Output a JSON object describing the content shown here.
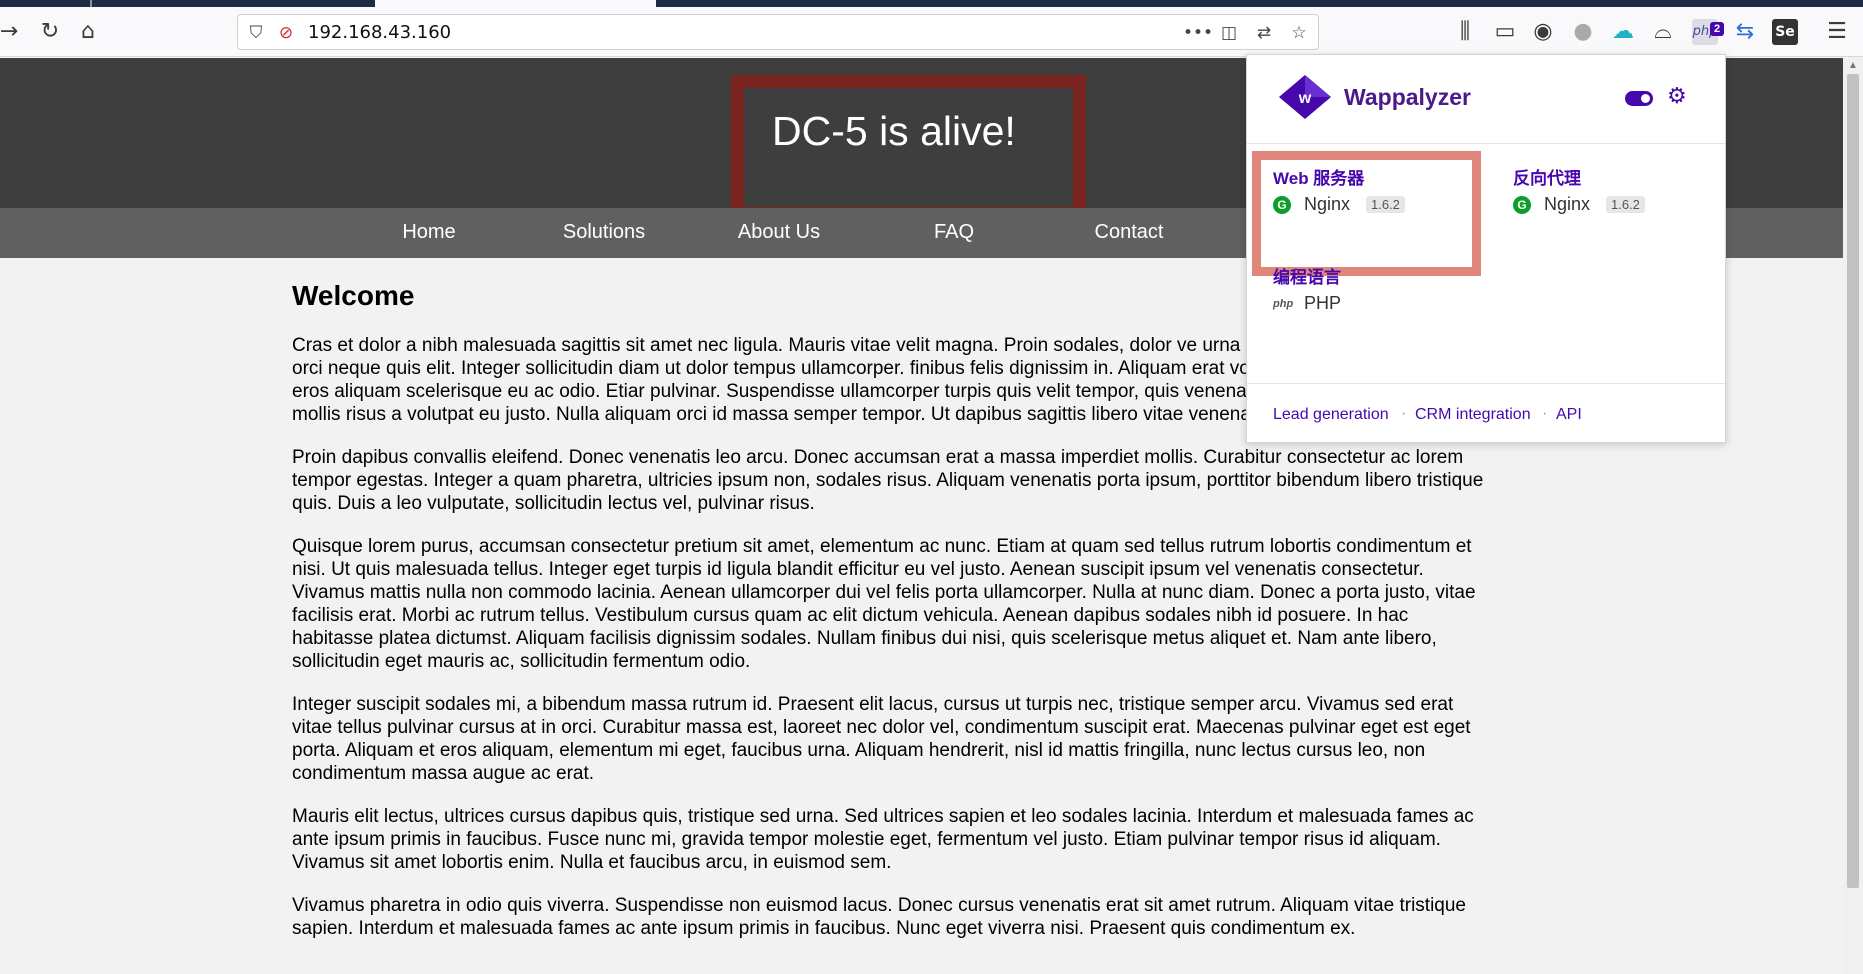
{
  "browser": {
    "url": "192.168.43.160",
    "toolbar_icons": {
      "back": "arrow-left-icon",
      "reload": "reload-icon",
      "home": "home-icon",
      "more": "•••",
      "library": "library-icon",
      "sidebar": "sidebar-icon",
      "account": "account-icon",
      "wappalyzer_badge": "2",
      "menu": "hamburger-icon"
    }
  },
  "site": {
    "title": "DC-5 is alive!",
    "nav": [
      "Home",
      "Solutions",
      "About Us",
      "FAQ",
      "Contact"
    ],
    "heading": "Welcome",
    "paragraphs": [
      "Cras et dolor a nibh malesuada sagittis sit amet nec ligula. Mauris vitae velit magna. Proin sodales, dolor ve urna malesuada diam, ac pulvinar orci neque quis elit. Integer sollicitudin diam ut dolor tempus ullamcorper. finibus felis dignissim in. Aliquam erat volutpat. Quisque a diam ut eros aliquam scelerisque eu ac odio. Etiar pulvinar. Suspendisse ullamcorper turpis quis velit tempor, quis venenatis metus iaculis. Mauris mollis risus a volutpat eu justo. Nulla aliquam orci id massa semper tempor. Ut dapibus sagittis libero vitae venenatis.",
      "Proin dapibus convallis eleifend. Donec venenatis leo arcu. Donec accumsan erat a massa imperdiet mollis. Curabitur consectetur ac lorem tempor egestas. Integer a quam pharetra, ultricies ipsum non, sodales risus. Aliquam venenatis porta ipsum, porttitor bibendum libero tristique quis. Duis a leo vulputate, sollicitudin lectus vel, pulvinar risus.",
      "Quisque lorem purus, accumsan consectetur pretium sit amet, elementum ac nunc. Etiam at quam sed tellus rutrum lobortis condimentum et nisi. Ut quis malesuada tellus. Integer eget turpis id ligula blandit efficitur eu vel justo. Aenean suscipit ipsum vel venenatis consectetur. Vivamus mattis nulla non commodo lacinia. Aenean ullamcorper dui vel felis porta ullamcorper. Nulla at nunc diam. Donec a porta justo, vitae facilisis erat. Morbi ac rutrum tellus. Vestibulum cursus quam ac elit dictum vehicula. Aenean dapibus sodales nibh id posuere. In hac habitasse platea dictumst. Aliquam facilisis dignissim sodales. Nullam finibus dui nisi, quis scelerisque metus aliquet et. Nam ante libero, sollicitudin eget mauris ac, sollicitudin fermentum odio.",
      "Integer suscipit sodales mi, a bibendum massa rutrum id. Praesent elit lacus, cursus ut turpis nec, tristique semper arcu. Vivamus sed erat vitae tellus pulvinar cursus at in orci. Curabitur massa est, laoreet nec dolor vel, condimentum suscipit erat. Maecenas pulvinar eget est eget porta. Aliquam et eros aliquam, elementum mi eget, faucibus urna. Aliquam hendrerit, nisl id mattis fringilla, nunc lectus cursus leo, non condimentum massa augue ac erat.",
      "Mauris elit lectus, ultrices cursus dapibus quis, tristique sed urna. Sed ultrices sapien et leo sodales lacinia. Interdum et malesuada fames ac ante ipsum primis in faucibus. Fusce nunc mi, gravida tempor molestie eget, fermentum vel justo. Etiam pulvinar tempor risus id aliquam. Vivamus sit amet lobortis enim. Nulla et faucibus arcu, in euismod sem.",
      "Vivamus pharetra in odio quis viverra. Suspendisse non euismod lacus. Donec cursus venenatis erat sit amet rutrum. Aliquam vitae tristique sapien. Interdum et malesuada fames ac ante ipsum primis in faucibus. Nunc eget viverra nisi. Praesent quis condimentum ex."
    ]
  },
  "wappalyzer": {
    "brand": "Wappalyzer",
    "categories": [
      {
        "name": "Web 服务器",
        "tech": "Nginx",
        "version": "1.6.2"
      },
      {
        "name": "反向代理",
        "tech": "Nginx",
        "version": "1.6.2"
      },
      {
        "name": "编程语言",
        "tech": "PHP",
        "icon_text": "php"
      }
    ],
    "footer_links": [
      "Lead generation",
      "CRM integration",
      "API"
    ],
    "colors": {
      "accent": "#4608ad",
      "highlight": "#e0867a",
      "title_box": "#7a2420"
    }
  }
}
